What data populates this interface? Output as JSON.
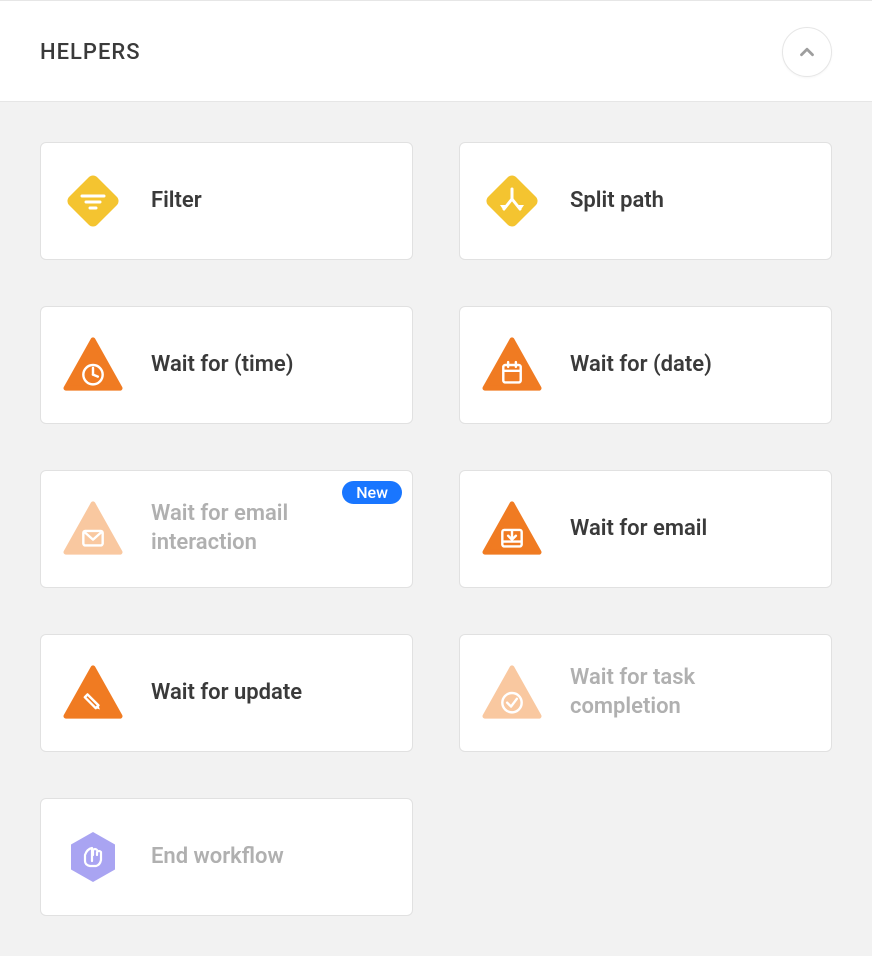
{
  "section": {
    "title": "HELPERS",
    "badge_new": "New"
  },
  "cards": [
    {
      "label": "Filter"
    },
    {
      "label": "Split path"
    },
    {
      "label": "Wait for (time)"
    },
    {
      "label": "Wait for (date)"
    },
    {
      "label": "Wait for email interaction"
    },
    {
      "label": "Wait for email"
    },
    {
      "label": "Wait for update"
    },
    {
      "label": "Wait for task completion"
    },
    {
      "label": "End workflow"
    }
  ],
  "colors": {
    "yellow": "#f4c430",
    "orange": "#f07b22",
    "orange_light": "#f9c8a0",
    "purple": "#a9a4f2"
  }
}
